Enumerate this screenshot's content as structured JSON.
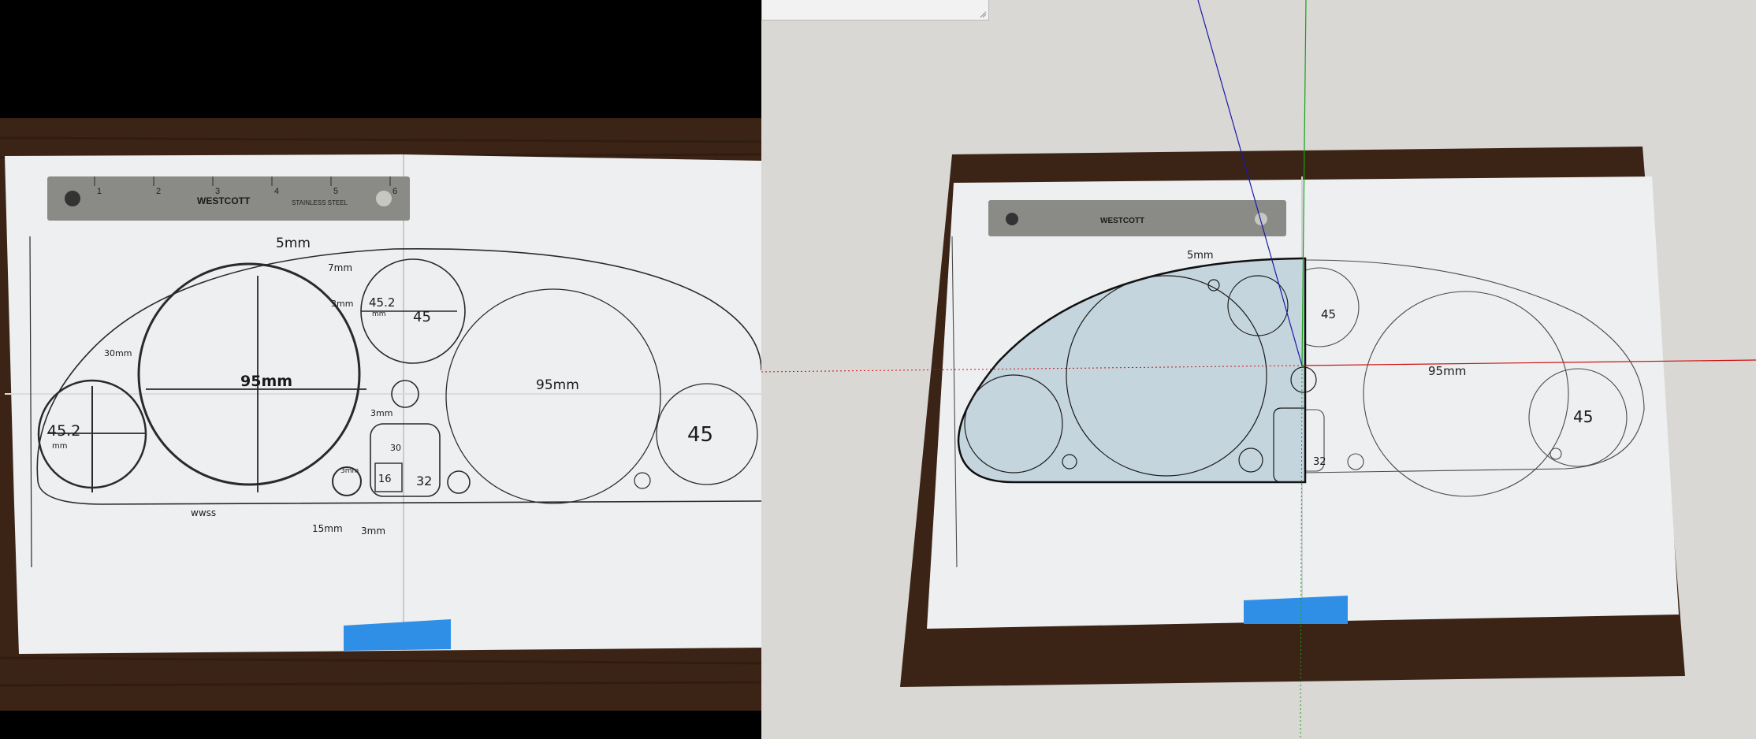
{
  "photo": {
    "ruler_brand": "WESTCOTT",
    "ruler_material": "STAINLESS STEEL",
    "ruler_numbers": [
      "1",
      "2",
      "3",
      "4",
      "5",
      "6"
    ],
    "labels": {
      "top_5mm": "5mm",
      "center_95": "95mm",
      "right_95": "95mm",
      "left_452": "45.2",
      "left_452_unit": "mm",
      "top_452": "45.2",
      "top_452_unit": "mm",
      "top_45": "45",
      "right_45": "45",
      "seven_mm": "7mm",
      "three_mm_a": "3mm",
      "thirty_mm": "30mm",
      "three_mm_b": "3mm",
      "fifteen_mm": "15mm",
      "three_mm_c": "3mm",
      "box_16": "16",
      "box_32": "32",
      "box_30": "30",
      "small_3mm": "3mm",
      "bottom_note": "wwss"
    }
  },
  "viewport": {
    "background": "#d9d8d4",
    "face_fill": "#c5d5de",
    "axis_colors": {
      "red": "#cc1111",
      "green": "#13a313",
      "blue": "#1a1aa8"
    },
    "model_labels": {
      "left_45": "45",
      "right_45": "45",
      "right_95": "95mm",
      "box_32": "32",
      "top_5mm": "5mm"
    }
  }
}
